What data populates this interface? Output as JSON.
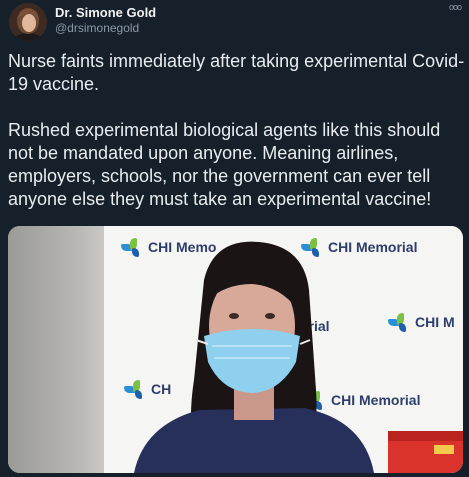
{
  "author": {
    "display_name": "Dr. Simone Gold",
    "handle": "@drsimonegold"
  },
  "tweet": {
    "line1": "Nurse faints immediately after taking experimental Covid-19 vaccine.",
    "line2": "Rushed experimental biological agents like this should not be mandated upon anyone. Meaning airlines, employers, schools, nor the government can ever tell anyone else they must take an experimental vaccine!"
  },
  "more_icon": "ooo",
  "media": {
    "logos": [
      "CHI Memo",
      "CHI Memorial",
      "orial",
      "CHI M",
      "CH",
      "CHI Memorial"
    ]
  },
  "colors": {
    "background": "#15202b",
    "text": "#e7e9ea",
    "secondary": "#8b98a5",
    "logo_text": "#2f3d6b",
    "mask": "#8fd0ee",
    "scrubs": "#27305a"
  },
  "icons": [
    "more-options-icon",
    "chi-logo-icon"
  ]
}
